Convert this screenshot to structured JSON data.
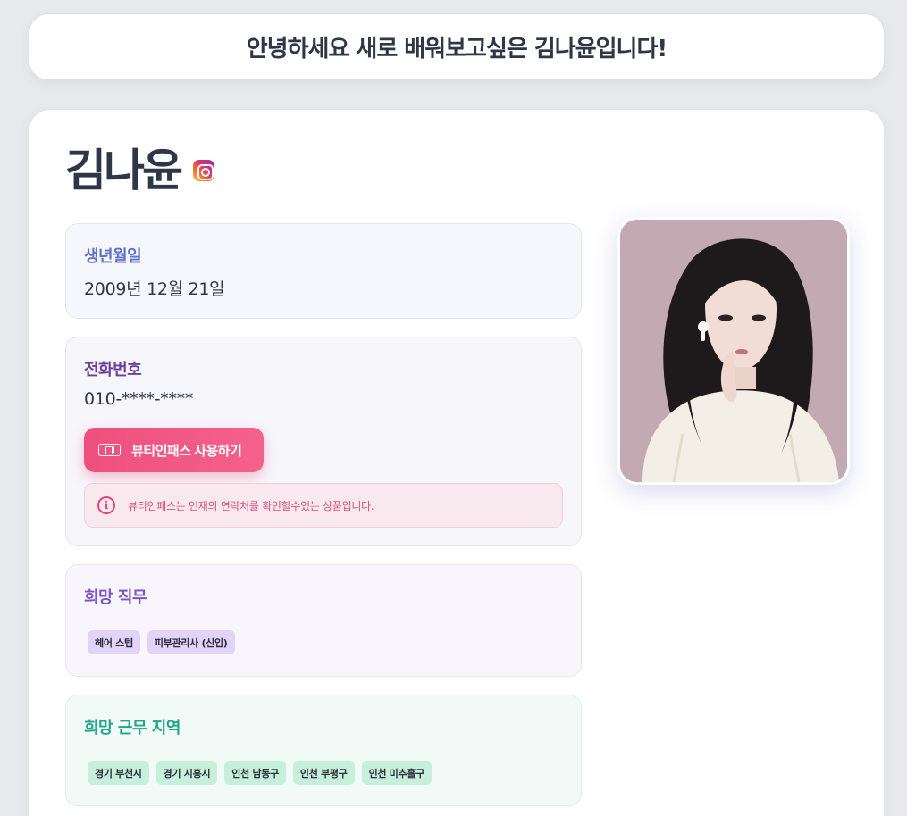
{
  "header": {
    "greeting": "안녕하세요 새로 배워보고싶은 김나윤입니다!"
  },
  "profile": {
    "name": "김나윤",
    "instagram_icon": "instagram-icon",
    "birth": {
      "title": "생년월일",
      "value": "2009년 12월 21일"
    },
    "phone": {
      "title": "전화번호",
      "value": "010-****-****",
      "button_label": "뷰티인패스 사용하기",
      "button_icon": "ticket-icon",
      "notice": "뷰티인패스는 인재의 연락처를 확인할수있는 상품입니다.",
      "notice_icon": "info-icon"
    },
    "job": {
      "title": "희망 직무",
      "tags": [
        "헤어 스텝",
        "피부관리사 (신입)"
      ]
    },
    "area": {
      "title": "희망 근무 지역",
      "tags": [
        "경기 부천시",
        "경기 시흥시",
        "인천 남동구",
        "인천 부평구",
        "인천 미추홀구"
      ]
    },
    "photo": "profile-photo"
  },
  "colors": {
    "page_bg": "#e8e9ec",
    "card_bg": "#ffffff",
    "accent_pink": "#ef4f7d",
    "birth_title": "#5f72c7",
    "phone_title": "#6b3fa0",
    "job_title": "#7b55c9",
    "area_title": "#22a58b",
    "job_tag": "#e2d3f8",
    "area_tag": "#c6f0dc"
  }
}
